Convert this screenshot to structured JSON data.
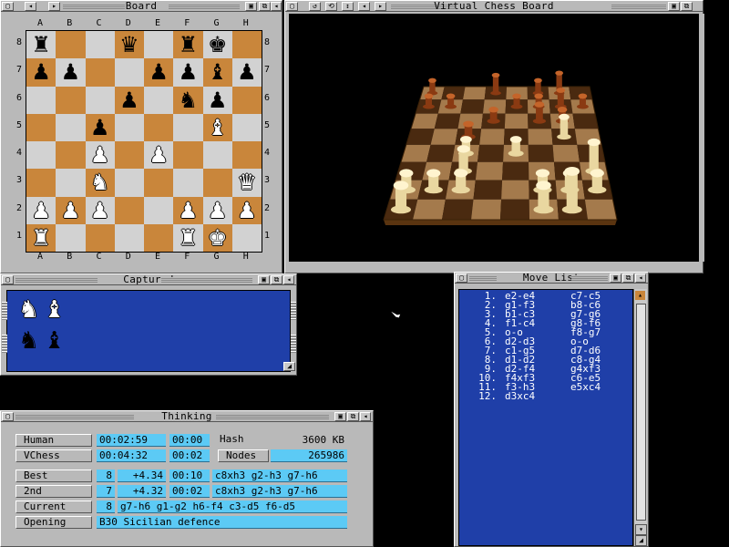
{
  "board_window": {
    "title": "Board",
    "files": [
      "A",
      "B",
      "C",
      "D",
      "E",
      "F",
      "G",
      "H"
    ],
    "ranks": [
      "8",
      "7",
      "6",
      "5",
      "4",
      "3",
      "2",
      "1"
    ],
    "position": [
      [
        "r",
        "",
        "",
        "q",
        "",
        "r",
        "k",
        ""
      ],
      [
        "p",
        "p",
        "",
        "",
        "p",
        "p",
        "b",
        "p"
      ],
      [
        "",
        "",
        "",
        "p",
        "",
        "n",
        "p",
        ""
      ],
      [
        "",
        "",
        "p",
        "",
        "",
        "",
        "B",
        ""
      ],
      [
        "",
        "",
        "P",
        "",
        "P",
        "",
        "",
        ""
      ],
      [
        "",
        "",
        "N",
        "",
        "",
        "",
        "",
        "Q"
      ],
      [
        "P",
        "P",
        "P",
        "",
        "",
        "P",
        "P",
        "P"
      ],
      [
        "R",
        "",
        "",
        "",
        "",
        "R",
        "K",
        ""
      ]
    ]
  },
  "virtual_window": {
    "title": "Virtual Chess Board"
  },
  "captured_window": {
    "title": "Captured",
    "white_row": [
      "N",
      "B"
    ],
    "black_row": [
      "n",
      "b"
    ]
  },
  "movelist_window": {
    "title": "Move List",
    "moves": [
      {
        "n": "1.",
        "w": "e2-e4",
        "b": "c7-c5"
      },
      {
        "n": "2.",
        "w": "g1-f3",
        "b": "b8-c6"
      },
      {
        "n": "3.",
        "w": "b1-c3",
        "b": "g7-g6"
      },
      {
        "n": "4.",
        "w": "f1-c4",
        "b": "g8-f6"
      },
      {
        "n": "5.",
        "w": "o-o",
        "b": "f8-g7"
      },
      {
        "n": "6.",
        "w": "d2-d3",
        "b": "o-o"
      },
      {
        "n": "7.",
        "w": "c1-g5",
        "b": "d7-d6"
      },
      {
        "n": "8.",
        "w": "d1-d2",
        "b": "c8-g4"
      },
      {
        "n": "9.",
        "w": "d2-f4",
        "b": "g4xf3"
      },
      {
        "n": "10.",
        "w": "f4xf3",
        "b": "c6-e5"
      },
      {
        "n": "11.",
        "w": "f3-h3",
        "b": "e5xc4"
      },
      {
        "n": "12.",
        "w": "d3xc4",
        "b": ""
      }
    ]
  },
  "thinking_window": {
    "title": "Thinking",
    "human_label": "Human",
    "human_time": "00:02:59",
    "human_move_time": "00:00",
    "vchess_label": "VChess",
    "vchess_time": "00:04:32",
    "vchess_move_time": "00:02",
    "hash_label": "Hash",
    "hash_value": "3600 KB",
    "nodes_label": "Nodes",
    "nodes_value": "265986",
    "best_label": "Best",
    "best_depth": "8",
    "best_score": "+4.34",
    "best_time": "00:10",
    "best_line": "c8xh3 g2-h3 g7-h6",
    "second_label": "2nd",
    "second_depth": "7",
    "second_score": "+4.32",
    "second_time": "00:02",
    "second_line": "c8xh3 g2-h3 g7-h6",
    "current_label": "Current",
    "current_depth": "8",
    "current_line": "g7-h6 g1-g2 h6-f4 c3-d5 f6-d5",
    "opening_label": "Opening",
    "opening_value": "B30 Sicilian defence"
  },
  "colors": {
    "board_light": "#d2d2d2",
    "board_dark": "#c9863b",
    "panel_blue": "#1f3fa8",
    "field_cyan": "#5ccaf5"
  }
}
